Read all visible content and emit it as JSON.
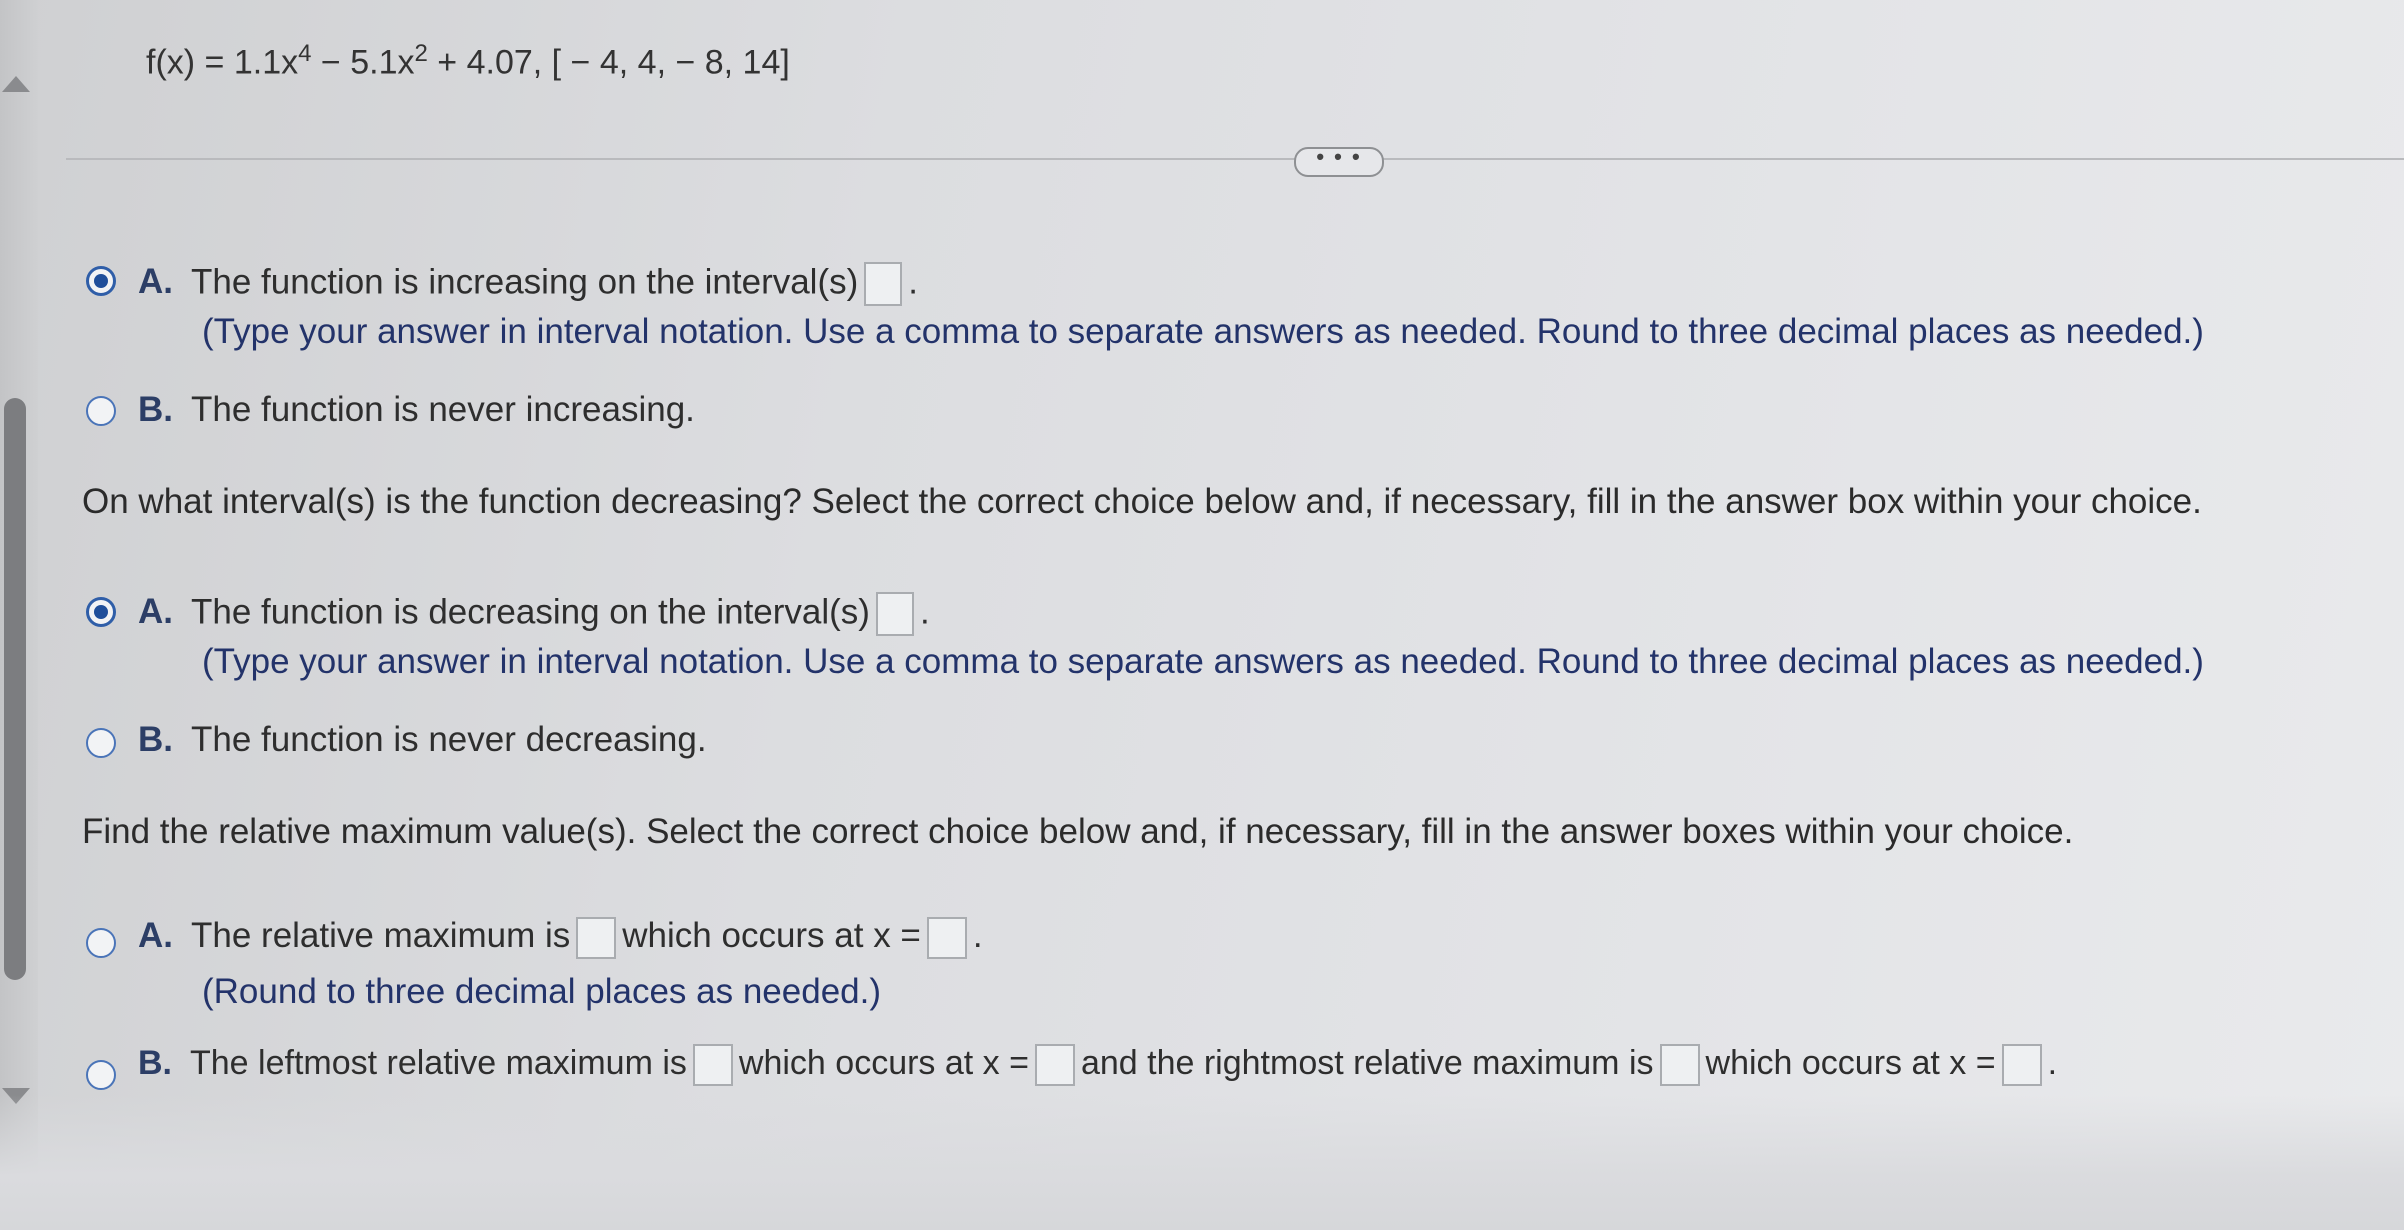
{
  "problem": {
    "formula_prefix": "f(x) = 1.1x",
    "exp1": "4",
    "formula_mid": " − 5.1x",
    "exp2": "2",
    "formula_suffix": " + 4.07, [ − 4, 4,  − 8, 14]"
  },
  "more_button": "• • •",
  "increasing": {
    "option_a_letter": "A.",
    "option_a_text": "The function is increasing on the interval(s)",
    "option_a_note": "(Type your answer in interval notation. Use a comma to separate answers as needed. Round to three decimal places as needed.)",
    "option_b_letter": "B.",
    "option_b_text": "The function is never increasing."
  },
  "decreasing": {
    "question": "On what interval(s) is the function decreasing? Select the correct choice below and, if necessary, fill in the answer box within your choice.",
    "option_a_letter": "A.",
    "option_a_text": "The function is decreasing on the interval(s)",
    "option_a_note": "(Type your answer in interval notation. Use a comma to separate answers as needed. Round to three decimal places as needed.)",
    "option_b_letter": "B.",
    "option_b_text": "The function is never decreasing."
  },
  "relative_max": {
    "question": "Find the relative maximum value(s). Select the correct choice below and, if necessary, fill in the answer boxes within your choice.",
    "option_a_letter": "A.",
    "option_a_text1": "The relative maximum is",
    "option_a_text2": "which occurs at x =",
    "option_a_note": "(Round to three decimal places as needed.)",
    "option_b_letter": "B.",
    "option_b_text1": "The leftmost relative maximum is",
    "option_b_text2": "which occurs at x =",
    "option_b_text3": "and the rightmost relative maximum is",
    "option_b_text4": "which occurs at x ="
  },
  "period": "."
}
